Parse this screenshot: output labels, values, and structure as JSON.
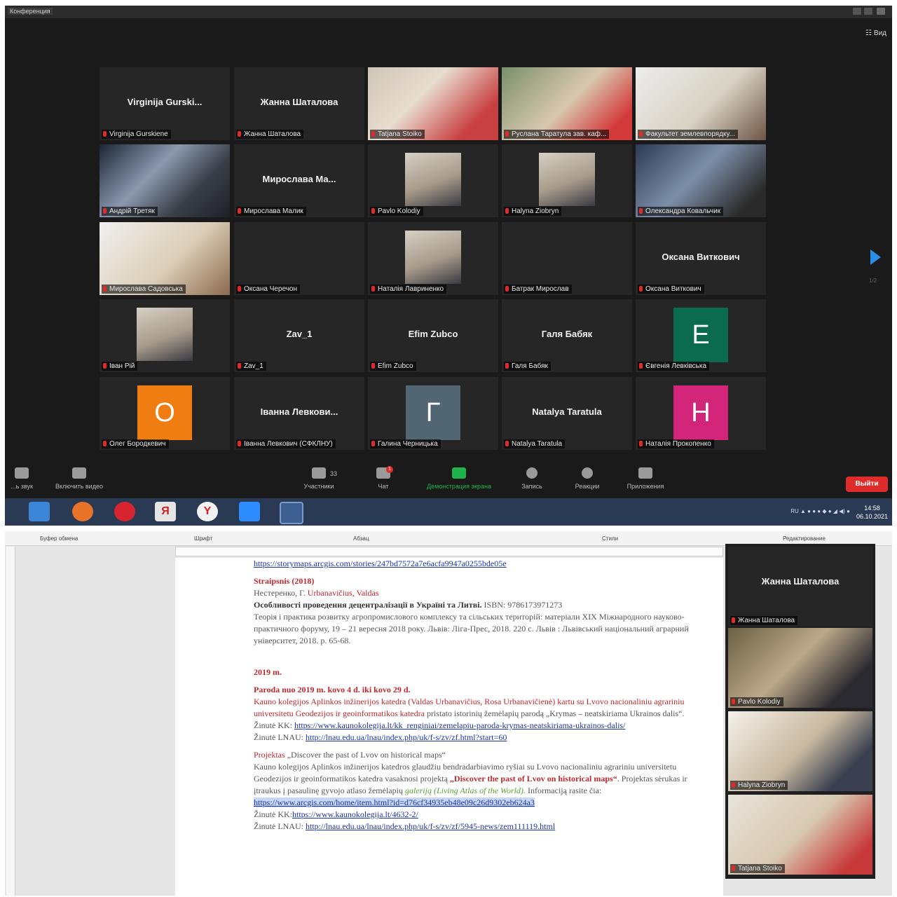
{
  "zoom": {
    "window_title": "Конференция",
    "view_label": "Вид",
    "gallery": [
      {
        "name": "Virginija Gurski...",
        "label": "Virginija Gurskiene",
        "type": "name"
      },
      {
        "name": "Жанна Шаталова",
        "label": "Жанна Шаталова",
        "type": "name"
      },
      {
        "name": "",
        "label": "Tatjana Stoiko",
        "type": "video"
      },
      {
        "name": "",
        "label": "Руслана Таратула зав. каф...",
        "type": "video"
      },
      {
        "name": "",
        "label": "Факультет землевпорядку...",
        "type": "video"
      },
      {
        "name": "",
        "label": "Андрій Третяк",
        "type": "video",
        "active": true
      },
      {
        "name": "Мирослава Ма...",
        "label": "Мирослава Малик",
        "type": "name"
      },
      {
        "name": "",
        "label": "Pavlo Kolodiy",
        "type": "photo"
      },
      {
        "name": "",
        "label": "Halyna Ziobryn",
        "type": "photo"
      },
      {
        "name": "",
        "label": "Олександра Ковальчик",
        "type": "video"
      },
      {
        "name": "",
        "label": "Мирослава Садовська",
        "type": "video"
      },
      {
        "name": "",
        "label": "Оксана Черечон",
        "type": "empty"
      },
      {
        "name": "",
        "label": "Наталія Лавриненко",
        "type": "photo"
      },
      {
        "name": "",
        "label": "Батрак Мирослав",
        "type": "empty"
      },
      {
        "name": "Оксана Виткович",
        "label": "Оксана Виткович",
        "type": "name"
      },
      {
        "name": "",
        "label": "Іван Рій",
        "type": "photo"
      },
      {
        "name": "Zav_1",
        "label": "Zav_1",
        "type": "name"
      },
      {
        "name": "Efim Zubco",
        "label": "Efim Zubco",
        "type": "name"
      },
      {
        "name": "Галя Бабяк",
        "label": "Галя Бабяк",
        "type": "name"
      },
      {
        "name": "E",
        "label": "Євгенія Левківська",
        "type": "avatar",
        "color": "#0b6b4f"
      },
      {
        "name": "O",
        "label": "Олег Бородкевич",
        "type": "avatar",
        "color": "#f07d12"
      },
      {
        "name": "Іванна Левкови...",
        "label": "Іванна Левкович (СФКЛНУ)",
        "type": "name"
      },
      {
        "name": "Г",
        "label": "Галина Черницька",
        "type": "avatar",
        "color": "#516672"
      },
      {
        "name": "Natalya Taratula",
        "label": "Natalya Taratula",
        "type": "name"
      },
      {
        "name": "H",
        "label": "Наталія Прокопенко",
        "type": "avatar",
        "color": "#d3267a"
      }
    ],
    "page_indicator": "1/2",
    "controls": {
      "audio": "...ь звук",
      "video": "Включить видео",
      "participants": "Участники",
      "participants_count": "33",
      "chat": "Чат",
      "chat_badge": "1",
      "share": "Демонстрация экрана",
      "record": "Запись",
      "reactions": "Реакции",
      "apps": "Приложения",
      "leave": "Выйти"
    },
    "taskbar": {
      "lang": "RU",
      "time": "14:58",
      "date": "06.10.2021"
    }
  },
  "word": {
    "ribbon": {
      "clipboard": "Буфер обмена",
      "font": "Шрифт",
      "paragraph": "Абзац",
      "styles": "Стили",
      "editing": "Редактирование"
    },
    "doc": {
      "url0": "https://storymaps.arcgis.com/stories/247bd7572a7e6acfa9947a0255bde05e",
      "h2018": "Straipsnis (2018)",
      "authors2018a": "Нестеренко, Г. ",
      "authors2018b": "Urbanavičius, Valdas",
      "title2018": "Особливості проведення децентралізації в Україні та Литві.",
      "isbn2018": " ISBN: 9786173971273",
      "body2018": "Теорія і практика розвитку агропромислового комплексу та сільських територій: матеріали XIX Міжнародного науково-практичного форуму, 19 – 21 вересня 2018 року. Львів: Ліга-Прес, 2018. 220 с. Львів : Львівський національний аграрний університет, 2018. p. 65-68.",
      "h2019": "2019 m.",
      "paroda": "Paroda nuo 2019 m. kovo 4 d. iki kovo 29 d.",
      "paroda_body_red": "Kauno kolegijos Aplinkos inžinerijos katedra (Valdas Urbanavičius, Rosa Urbanavičienė) kartu su Lvovo nacionaliniu agrariniu universitetu Geodezijos ir geoinformatikos katedra",
      "paroda_body": " pristato istorinių žemėlapių parodą „Krymas – neatskiriama Ukrainos dalis“.",
      "kk_label": "Žinutė KK: ",
      "kk_link": "https://www.kaunokolegija.lt/kk_renginiai/zemelapiu-paroda-krymas-neatskiriama-ukrainos-dalis/",
      "lnau_label": "Žinutė LNAU: ",
      "lnau_link": "http://lnau.edu.ua/lnau/index.php/uk/f-s/zv/zf.html?start=60",
      "projektas_label": "Projektas",
      "projektas_title": " „Discover the past of Lvov on historical maps“",
      "proj_body_a": "Kauno kolegijos Aplinkos inžinerijos katedros glaudžiu bendradarbiavimo ryšiai su Lvovo nacionaliniu agrariniu universitetu Geodezijos ir geoinformatikos katedra vasaknosi projektą ",
      "proj_title_red": "„Discover the past of Lvov on historical maps“",
      "proj_body_b": ". Projektas sėrukas ir įtraukus į pasaulinę gyvojo atlaso žemėlapių ",
      "proj_gallery": "galeriją (Living Atlas of the World).",
      "proj_info": " Informaciją rasite čia:",
      "proj_link": "https://www.arcgis.com/home/item.html?id=d76cf34935eb48e09c26d9302eb624a3",
      "kk2_label": "Žinutė KK:",
      "kk2_link": "https://www.kaunokolegija.lt/4632-2/",
      "lnau2_label": "Žinutė LNAU: ",
      "lnau2_link": "http://lnau.edu.ua/lnau/index.php/uk/f-s/zv/zf/5945-news/zem111119.html"
    },
    "side": [
      {
        "name": "Жанна Шаталова",
        "label": "Жанна Шаталова",
        "type": "name"
      },
      {
        "name": "",
        "label": "Pavlo Kolodiy",
        "type": "video"
      },
      {
        "name": "",
        "label": "Halyna Ziobryn",
        "type": "video"
      },
      {
        "name": "",
        "label": "Tatjana Stoiko",
        "type": "video"
      }
    ]
  }
}
